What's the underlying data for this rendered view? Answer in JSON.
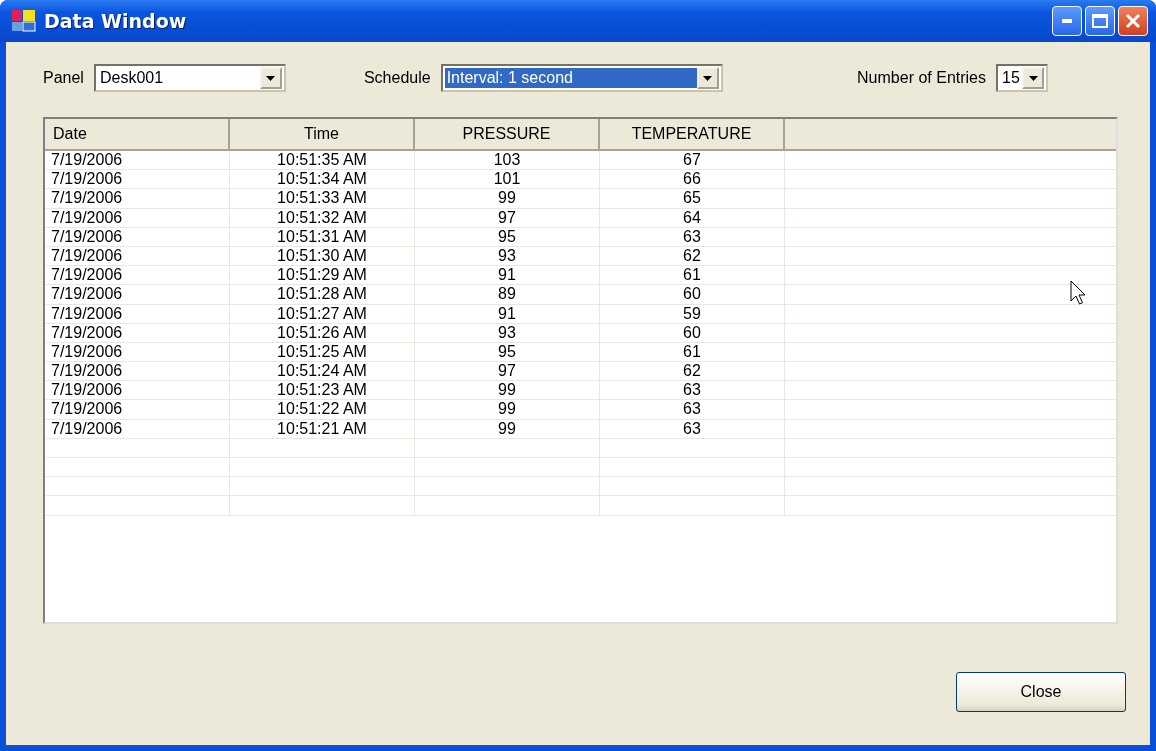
{
  "window": {
    "title": "Data Window"
  },
  "controls": [
    {
      "label": "Panel",
      "value": "Desk001",
      "highlighted": false
    },
    {
      "label": "Schedule",
      "value": "Interval: 1 second",
      "highlighted": true
    },
    {
      "label": "Number of Entries",
      "value": "15",
      "highlighted": false
    }
  ],
  "table": {
    "columns": [
      "Date",
      "Time",
      "PRESSURE",
      "TEMPERATURE"
    ],
    "rows": [
      [
        "7/19/2006",
        "10:51:35 AM",
        "103",
        "67"
      ],
      [
        "7/19/2006",
        "10:51:34 AM",
        "101",
        "66"
      ],
      [
        "7/19/2006",
        "10:51:33 AM",
        "99",
        "65"
      ],
      [
        "7/19/2006",
        "10:51:32 AM",
        "97",
        "64"
      ],
      [
        "7/19/2006",
        "10:51:31 AM",
        "95",
        "63"
      ],
      [
        "7/19/2006",
        "10:51:30 AM",
        "93",
        "62"
      ],
      [
        "7/19/2006",
        "10:51:29 AM",
        "91",
        "61"
      ],
      [
        "7/19/2006",
        "10:51:28 AM",
        "89",
        "60"
      ],
      [
        "7/19/2006",
        "10:51:27 AM",
        "91",
        "59"
      ],
      [
        "7/19/2006",
        "10:51:26 AM",
        "93",
        "60"
      ],
      [
        "7/19/2006",
        "10:51:25 AM",
        "95",
        "61"
      ],
      [
        "7/19/2006",
        "10:51:24 AM",
        "97",
        "62"
      ],
      [
        "7/19/2006",
        "10:51:23 AM",
        "99",
        "63"
      ],
      [
        "7/19/2006",
        "10:51:22 AM",
        "99",
        "63"
      ],
      [
        "7/19/2006",
        "10:51:21 AM",
        "99",
        "63"
      ]
    ]
  },
  "buttons": [
    "Close"
  ]
}
